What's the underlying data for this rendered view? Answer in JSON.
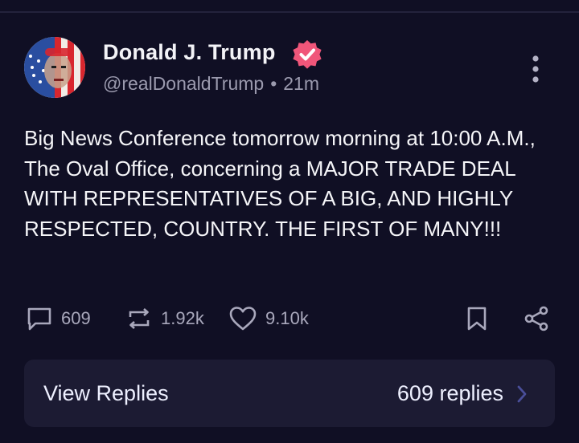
{
  "post": {
    "author_name": "Donald J. Trump",
    "handle": "@realDonaldTrump",
    "separator": "•",
    "time_ago": "21m",
    "body": "Big News Conference tomorrow morning at 10:00 A.M., The Oval Office, concerning a MAJOR TRADE DEAL WITH REPRESENTATIVES OF A BIG, AND HIGHLY RESPECTED, COUNTRY. THE FIRST OF MANY!!!"
  },
  "actions": {
    "replies_count": "609",
    "reposts_count": "1.92k",
    "likes_count": "9.10k"
  },
  "replies_bar": {
    "label": "View Replies",
    "count_label": "609 replies"
  },
  "colors": {
    "background": "#100f24",
    "verified_badge": "#f0567a",
    "muted_text": "#9b9aae",
    "replies_bar": "#1c1b33",
    "chevron": "#4a4f9a"
  },
  "icons": [
    "verified-badge-icon",
    "more-vertical-icon",
    "comment-icon",
    "repost-icon",
    "heart-icon",
    "bookmark-icon",
    "share-icon",
    "chevron-right-icon"
  ]
}
